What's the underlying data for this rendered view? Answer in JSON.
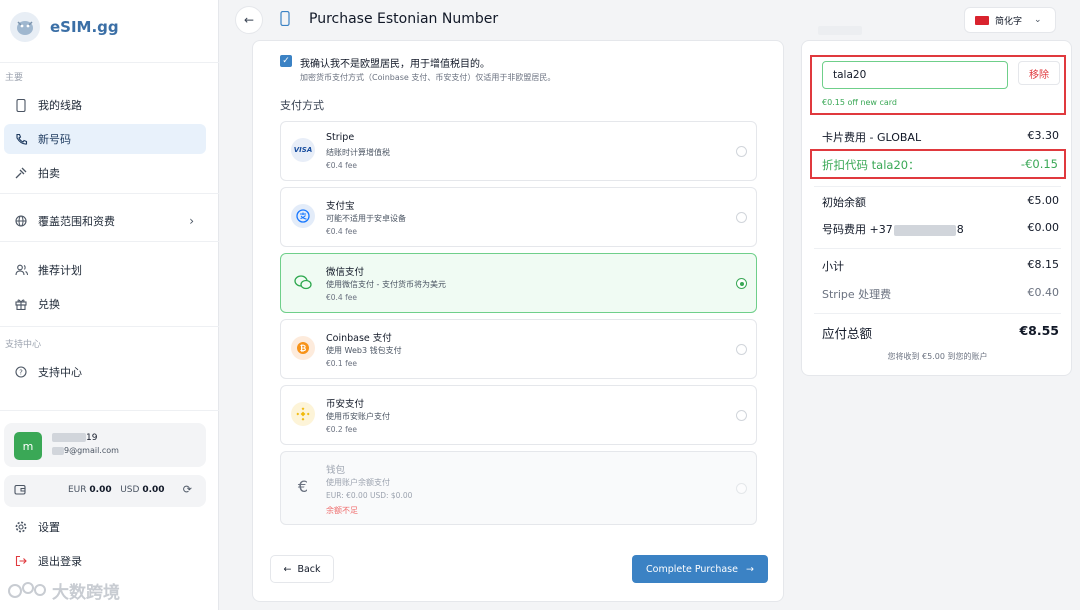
{
  "brand": {
    "name": "eSIM.gg"
  },
  "sidebar": {
    "section_main": "主要",
    "items": [
      {
        "label": "我的线路"
      },
      {
        "label": "新号码"
      },
      {
        "label": "拍卖"
      },
      {
        "label": "覆盖范围和资费"
      },
      {
        "label": "推荐计划"
      },
      {
        "label": "兑换"
      }
    ],
    "section_support": "支持中心",
    "support_item": "支持中心",
    "user": {
      "avatar": "m",
      "name_suffix": "19",
      "email_suffix": "9@gmail.com"
    },
    "wallet": {
      "eur_label": "EUR",
      "eur_value": "0.00",
      "usd_label": "USD",
      "usd_value": "0.00"
    },
    "settings": "设置",
    "logout": "退出登录",
    "watermark": "大数跨境"
  },
  "header": {
    "title": "Purchase Estonian Number",
    "language": "简化字"
  },
  "main": {
    "vat_confirm": "我确认我不是欧盟居民，用于增值税目的。",
    "vat_note": "加密货币支付方式（Coinbase 支付、币安支付）仅适用于非欧盟居民。",
    "payment_label": "支付方式",
    "methods": [
      {
        "name": "Stripe",
        "desc": "结账时计算增值税",
        "fee": "€0.4 fee",
        "icon": "VISA"
      },
      {
        "name": "支付宝",
        "desc": "可能不适用于安卓设备",
        "fee": "€0.4 fee"
      },
      {
        "name": "微信支付",
        "desc": "使用微信支付 - 支付货币将为美元",
        "fee": "€0.4 fee"
      },
      {
        "name": "Coinbase 支付",
        "desc": "使用 Web3 钱包支付",
        "fee": "€0.1 fee"
      },
      {
        "name": "币安支付",
        "desc": "使用币安账户支付",
        "fee": "€0.2 fee"
      },
      {
        "name": "钱包",
        "desc": "使用账户余额支付",
        "fee": "EUR: €0.00  USD: $0.00",
        "warning": "余额不足"
      }
    ],
    "back_label": "Back",
    "complete_label": "Complete Purchase"
  },
  "summary": {
    "coupon_value": "tala20",
    "remove_label": "移除",
    "coupon_note": "€0.15 off new card",
    "rows": [
      {
        "label": "卡片费用 - GLOBAL",
        "value": "€3.30"
      },
      {
        "label": "折扣代码 tala20：",
        "value": "-€0.15"
      },
      {
        "label": "初始余额",
        "value": "€5.00"
      },
      {
        "label": "号码费用 +37",
        "label_suffix": "8",
        "value": "€0.00"
      },
      {
        "label": "小计",
        "value": "€8.15"
      },
      {
        "label": "Stripe 处理费",
        "value": "€0.40"
      },
      {
        "label": "应付总额",
        "value": "€8.55"
      }
    ],
    "note": "您将收到 €5.00 到您的账户"
  },
  "colors": {
    "accent": "#3b82c4",
    "success": "#3aa856",
    "danger": "#e0393e"
  }
}
